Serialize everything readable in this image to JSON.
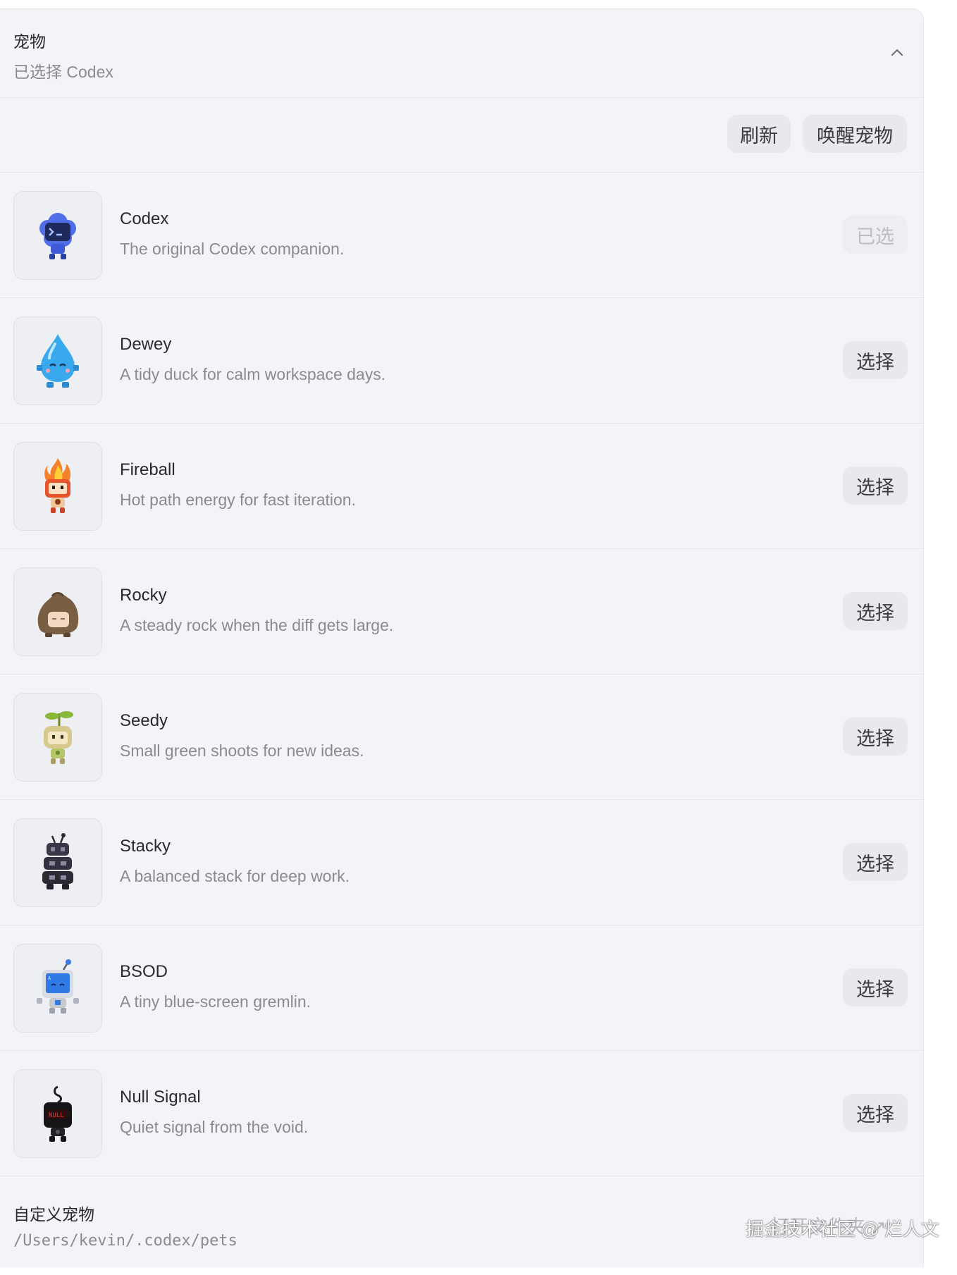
{
  "header": {
    "title": "宠物",
    "subtitle": "已选择 Codex"
  },
  "toolbar": {
    "refresh_label": "刷新",
    "wake_label": "唤醒宠物"
  },
  "pets": [
    {
      "name": "Codex",
      "description": "The original Codex companion.",
      "action": "已选",
      "selected": true
    },
    {
      "name": "Dewey",
      "description": "A tidy duck for calm workspace days.",
      "action": "选择",
      "selected": false
    },
    {
      "name": "Fireball",
      "description": "Hot path energy for fast iteration.",
      "action": "选择",
      "selected": false
    },
    {
      "name": "Rocky",
      "description": "A steady rock when the diff gets large.",
      "action": "选择",
      "selected": false
    },
    {
      "name": "Seedy",
      "description": "Small green shoots for new ideas.",
      "action": "选择",
      "selected": false
    },
    {
      "name": "Stacky",
      "description": "A balanced stack for deep work.",
      "action": "选择",
      "selected": false
    },
    {
      "name": "BSOD",
      "description": "A tiny blue-screen gremlin.",
      "action": "选择",
      "selected": false
    },
    {
      "name": "Null Signal",
      "description": "Quiet signal from the void.",
      "action": "选择",
      "selected": false
    }
  ],
  "custom": {
    "title": "自定义宠物",
    "path": "/Users/kevin/.codex/pets",
    "open_label": "打开文件夹 ↗"
  },
  "watermark": "掘金技术社区 @ 烂人文",
  "avatar_text": {
    "bsod": "A",
    "null": "NULL"
  }
}
